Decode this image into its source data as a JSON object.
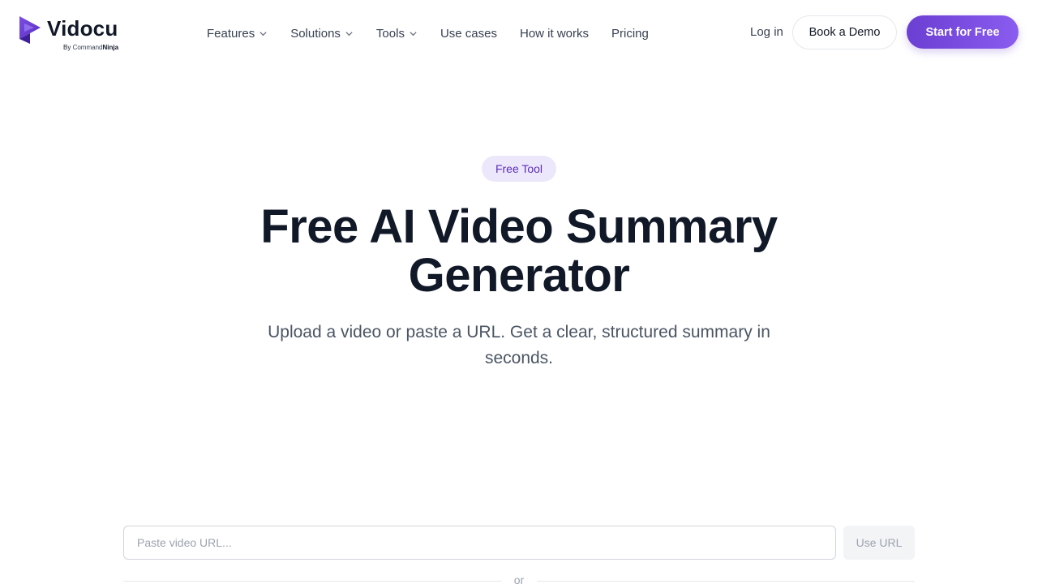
{
  "brand": {
    "name": "Vidocu",
    "by_prefix": "By",
    "by_company_part1": "Command",
    "by_company_part2": "Ninja",
    "primary_color": "#6b3fd1",
    "accent_color": "#8a5cf0"
  },
  "nav": {
    "items": [
      {
        "label": "Features",
        "has_dropdown": true
      },
      {
        "label": "Solutions",
        "has_dropdown": true
      },
      {
        "label": "Tools",
        "has_dropdown": true
      },
      {
        "label": "Use cases",
        "has_dropdown": false
      },
      {
        "label": "How it works",
        "has_dropdown": false
      },
      {
        "label": "Pricing",
        "has_dropdown": false
      }
    ],
    "login_label": "Log in",
    "demo_label": "Book a Demo",
    "start_label": "Start for Free"
  },
  "hero": {
    "badge": "Free Tool",
    "title_line1": "Free AI Video Summary",
    "title_line2": "Generator",
    "subtitle_line1": "Upload a video or paste a URL. Get a clear, structured summary in",
    "subtitle_line2": "seconds."
  },
  "url_form": {
    "placeholder": "Paste video URL...",
    "button_label": "Use URL",
    "separator": "or"
  }
}
